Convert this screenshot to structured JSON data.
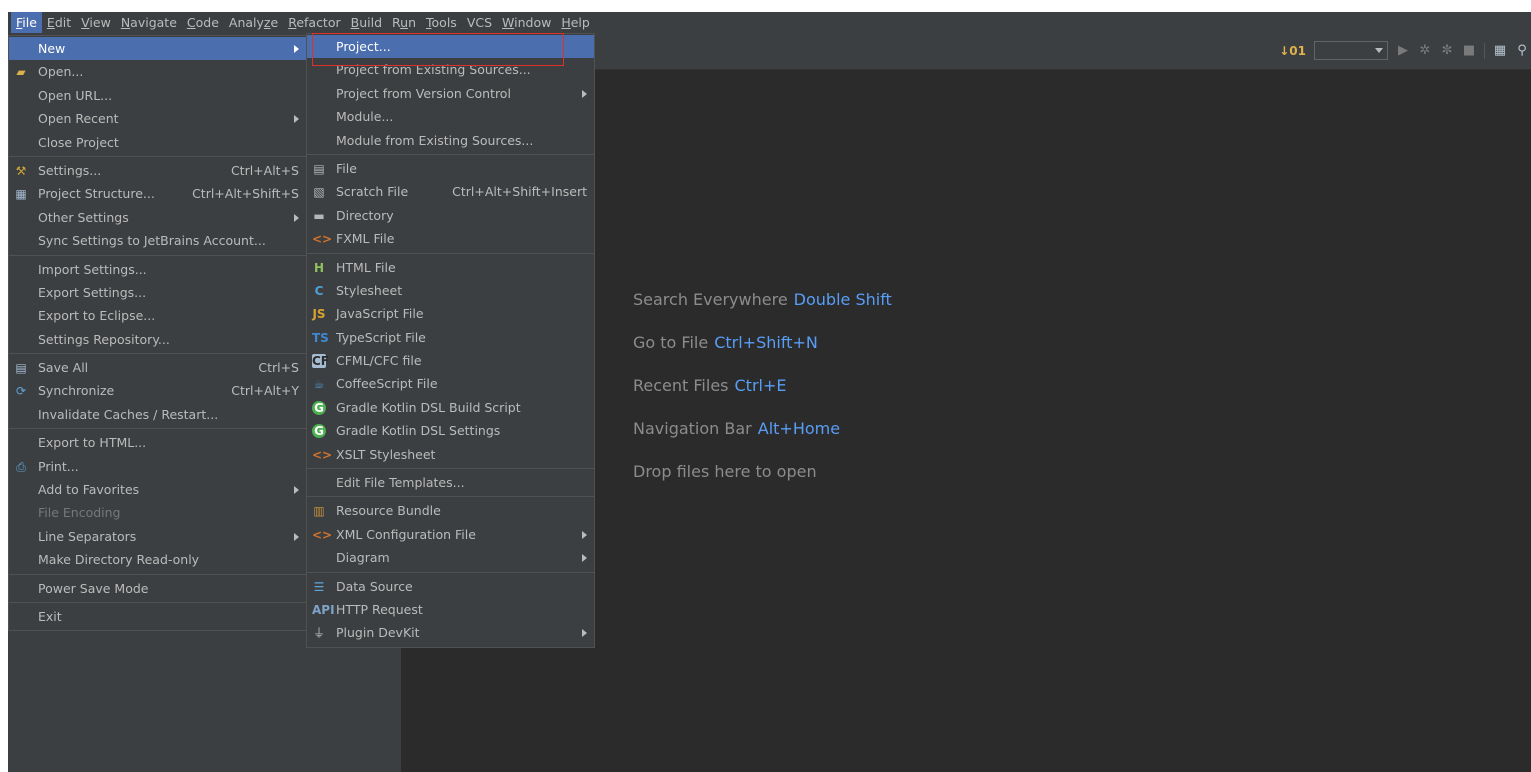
{
  "menubar": {
    "items": [
      {
        "label": "File",
        "u": "F",
        "rest": "ile"
      },
      {
        "label": "Edit",
        "u": "E",
        "rest": "dit"
      },
      {
        "label": "View",
        "u": "V",
        "rest": "iew"
      },
      {
        "label": "Navigate",
        "u": "N",
        "rest": "avigate"
      },
      {
        "label": "Code",
        "u": "C",
        "rest": "ode"
      },
      {
        "label": "Analyze",
        "pre": "Analy",
        "u": "z",
        "rest": "e"
      },
      {
        "label": "Refactor",
        "u": "R",
        "rest": "efactor"
      },
      {
        "label": "Build",
        "u": "B",
        "rest": "uild"
      },
      {
        "label": "Run",
        "pre": "R",
        "u": "u",
        "rest": "n"
      },
      {
        "label": "Tools",
        "u": "T",
        "rest": "ools"
      },
      {
        "label": "VCS",
        "u": "",
        "rest": "VCS"
      },
      {
        "label": "Window",
        "u": "W",
        "rest": "indow"
      },
      {
        "label": "Help",
        "u": "H",
        "rest": "elp"
      }
    ]
  },
  "toolbar": {
    "sort_icon_label": "↓01",
    "combo_value": ""
  },
  "file_menu": {
    "new": "New",
    "open": "Open...",
    "open_url": "Open URL...",
    "open_recent": "Open Recent",
    "close_project": "Close Project",
    "settings": "Settings...",
    "settings_sc": "Ctrl+Alt+S",
    "project_structure": "Project Structure...",
    "project_structure_sc": "Ctrl+Alt+Shift+S",
    "other_settings": "Other Settings",
    "sync_settings": "Sync Settings to JetBrains Account...",
    "import_settings": "Import Settings...",
    "export_settings": "Export Settings...",
    "export_eclipse": "Export to Eclipse...",
    "settings_repo": "Settings Repository...",
    "save_all": "Save All",
    "save_all_sc": "Ctrl+S",
    "synchronize": "Synchronize",
    "synchronize_sc": "Ctrl+Alt+Y",
    "invalidate": "Invalidate Caches / Restart...",
    "export_html": "Export to HTML...",
    "print": "Print...",
    "add_favorites": "Add to Favorites",
    "file_encoding": "File Encoding",
    "line_separators": "Line Separators",
    "make_readonly": "Make Directory Read-only",
    "power_save": "Power Save Mode",
    "exit": "Exit"
  },
  "new_menu": {
    "project": "Project...",
    "project_existing": "Project from Existing Sources...",
    "project_vcs": "Project from Version Control",
    "module": "Module...",
    "module_existing": "Module from Existing Sources...",
    "file": "File",
    "scratch_file": "Scratch File",
    "scratch_sc": "Ctrl+Alt+Shift+Insert",
    "directory": "Directory",
    "fxml": "FXML File",
    "html": "HTML File",
    "stylesheet": "Stylesheet",
    "javascript": "JavaScript File",
    "typescript": "TypeScript File",
    "cfml": "CFML/CFC file",
    "coffeescript": "CoffeeScript File",
    "gradle_build": "Gradle Kotlin DSL Build Script",
    "gradle_settings": "Gradle Kotlin DSL Settings",
    "xslt": "XSLT Stylesheet",
    "edit_templates": "Edit File Templates...",
    "resource_bundle": "Resource Bundle",
    "xml_config": "XML Configuration File",
    "diagram": "Diagram",
    "data_source": "Data Source",
    "http_request": "HTTP Request",
    "plugin_devkit": "Plugin DevKit"
  },
  "editor_hints": [
    {
      "label": "Search Everywhere",
      "key": "Double Shift"
    },
    {
      "label": "Go to File",
      "key": "Ctrl+Shift+N"
    },
    {
      "label": "Recent Files",
      "key": "Ctrl+E"
    },
    {
      "label": "Navigation Bar",
      "key": "Alt+Home"
    },
    {
      "label": "Drop files here to open",
      "key": ""
    }
  ],
  "colors": {
    "selection": "#4b6eaf",
    "key_hint": "#589df6",
    "callout": "#e0302b"
  }
}
